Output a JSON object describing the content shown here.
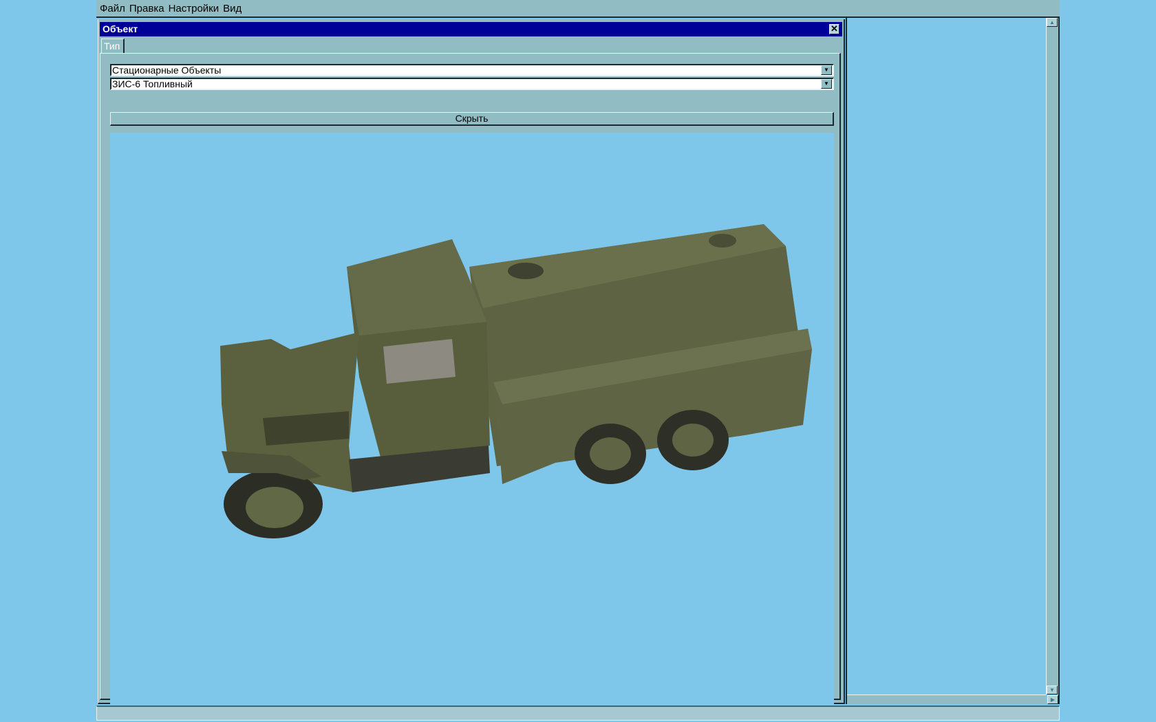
{
  "menu": {
    "items": [
      "Файл",
      "Правка",
      "Настройки",
      "Вид"
    ]
  },
  "window": {
    "title": "Объект",
    "close_icon": "close-icon"
  },
  "tabs": [
    {
      "label": "Тип",
      "active": true
    }
  ],
  "category_select": {
    "value": "Стационарные Объекты"
  },
  "object_select": {
    "value": "ЗИС-6 Топливный"
  },
  "hide_button": {
    "label": "Скрыть"
  },
  "colors": {
    "desktop": "#7ec6ea",
    "panel": "#92bcc4",
    "titlebar": "#000099",
    "truck": "#5a5f3e"
  }
}
